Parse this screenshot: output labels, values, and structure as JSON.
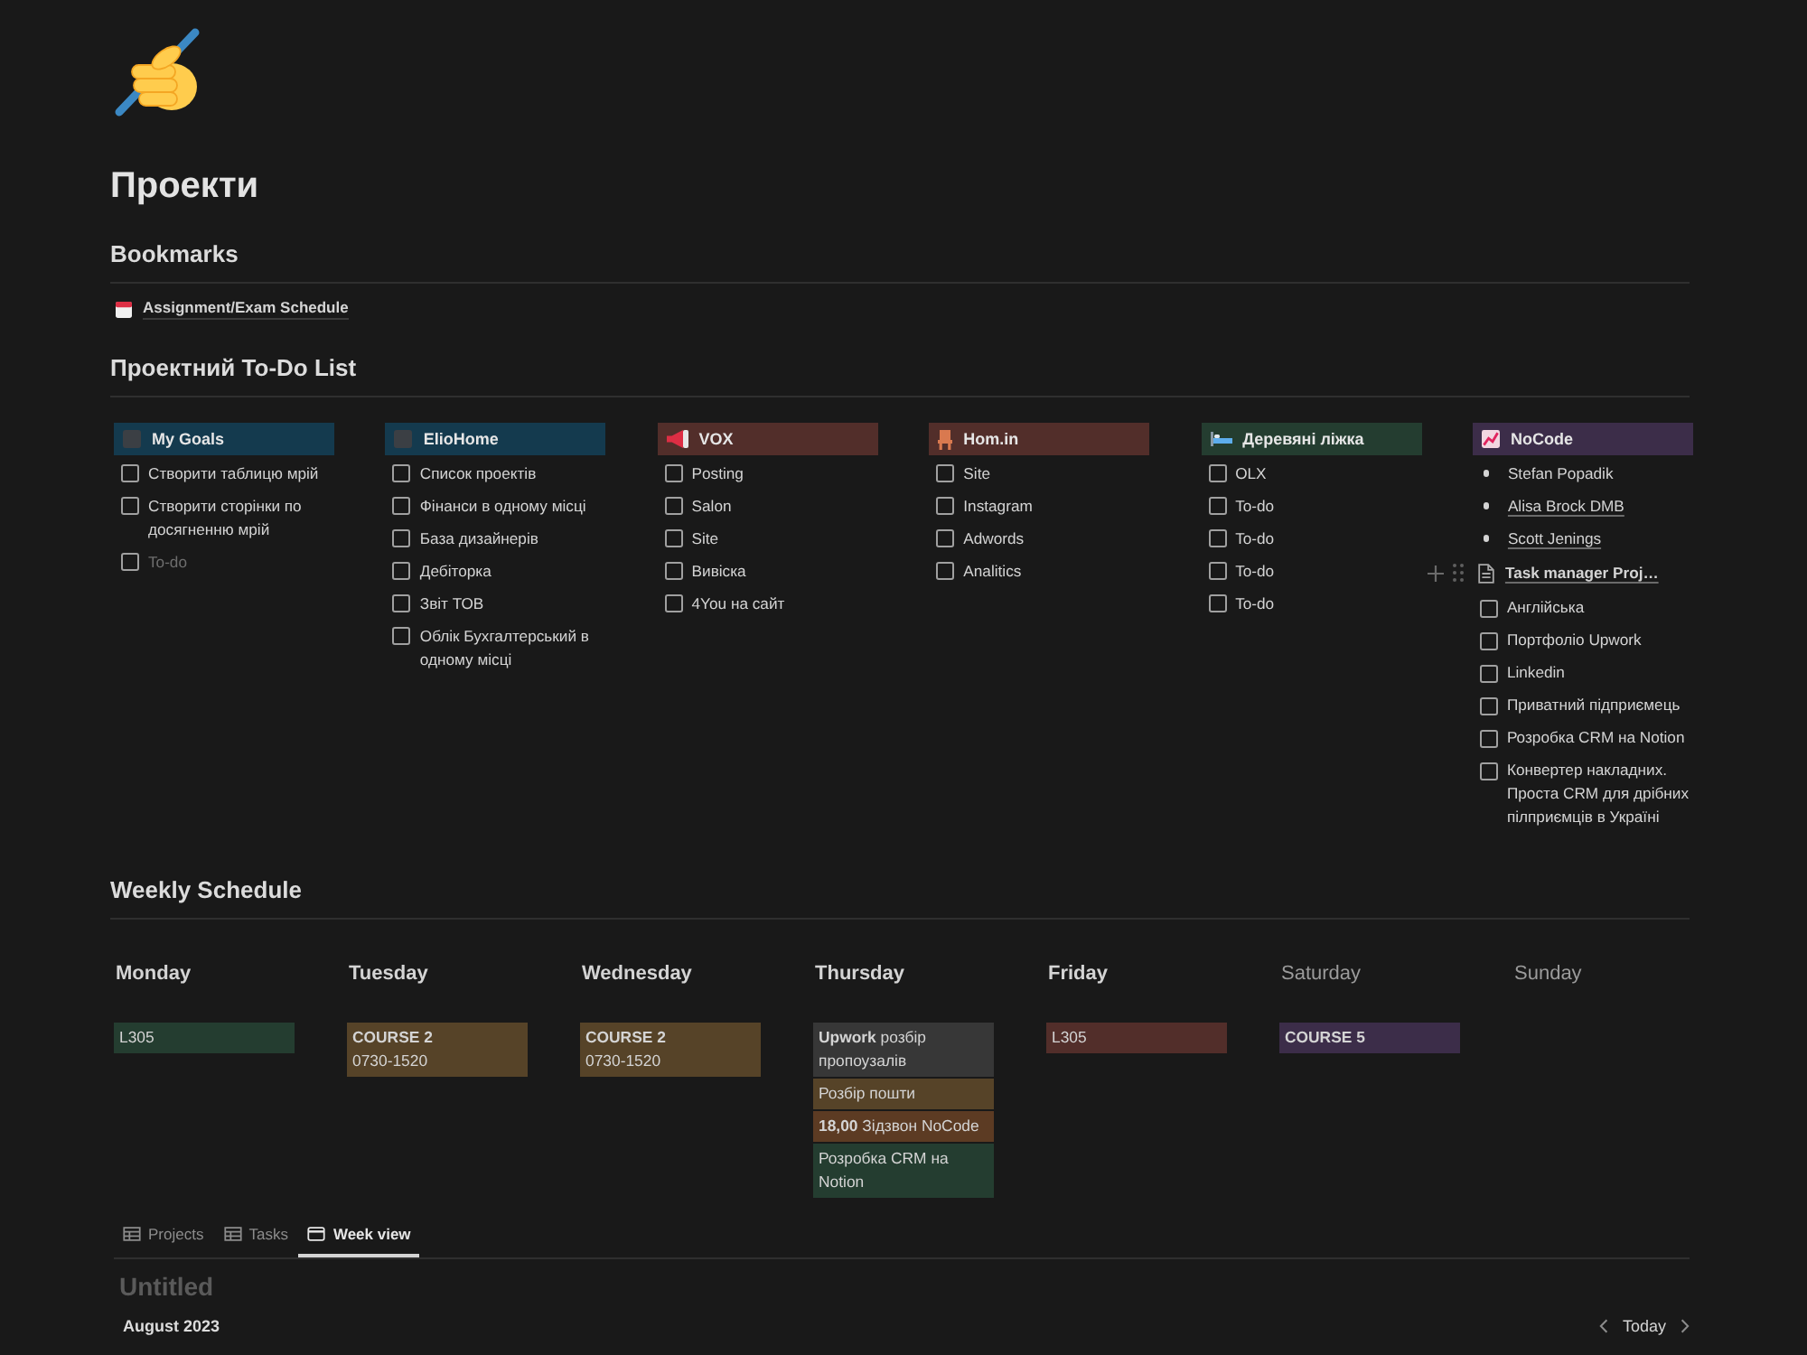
{
  "page": {
    "title": "Проекти"
  },
  "bookmarks": {
    "heading": "Bookmarks",
    "links": [
      {
        "text": "Assignment/Exam Schedule"
      }
    ]
  },
  "todo_list": {
    "heading": "Проектний To-Do List",
    "columns": [
      {
        "title": "My Goals",
        "color": "#143a4e",
        "items": [
          {
            "kind": "todo",
            "checked": false,
            "text": "Створити таблицю мрій"
          },
          {
            "kind": "todo",
            "checked": false,
            "text": "Створити сторінки по досягненню мрій"
          },
          {
            "kind": "todo",
            "checked": false,
            "placeholder": "To-do"
          }
        ]
      },
      {
        "title": "ElioHome",
        "color": "#143a4e",
        "items": [
          {
            "kind": "todo",
            "checked": false,
            "text": "Список проектів"
          },
          {
            "kind": "todo",
            "checked": false,
            "text": "Фінанси в одному місці"
          },
          {
            "kind": "todo",
            "checked": false,
            "text": "База дизайнерів"
          },
          {
            "kind": "todo",
            "checked": false,
            "text": "Дебіторка"
          },
          {
            "kind": "todo",
            "checked": false,
            "text": "Звіт ТОВ"
          },
          {
            "kind": "todo",
            "checked": false,
            "text": "Облік Бухгалтерський в одному місці"
          }
        ]
      },
      {
        "title": "VOX",
        "color": "#522e2a",
        "items": [
          {
            "kind": "todo",
            "checked": false,
            "text": "Posting"
          },
          {
            "kind": "todo",
            "checked": false,
            "text": "Salon"
          },
          {
            "kind": "todo",
            "checked": false,
            "text": "Site"
          },
          {
            "kind": "todo",
            "checked": false,
            "text": "Вивіска"
          },
          {
            "kind": "todo",
            "checked": false,
            "text": "4You на сайт"
          }
        ]
      },
      {
        "title": "Hom.in",
        "color": "#522e2a",
        "items": [
          {
            "kind": "todo",
            "checked": false,
            "text": "Site"
          },
          {
            "kind": "todo",
            "checked": false,
            "text": "Instagram"
          },
          {
            "kind": "todo",
            "checked": false,
            "text": "Adwords"
          },
          {
            "kind": "todo",
            "checked": false,
            "text": "Analitics"
          }
        ]
      },
      {
        "title": "Деревяні ліжка",
        "color": "#243d30",
        "items": [
          {
            "kind": "todo",
            "checked": false,
            "text": "OLX"
          },
          {
            "kind": "todo",
            "checked": false,
            "text": "To-do"
          },
          {
            "kind": "todo",
            "checked": false,
            "text": "To-do"
          },
          {
            "kind": "todo",
            "checked": false,
            "text": "To-do"
          },
          {
            "kind": "todo",
            "checked": false,
            "text": "To-do"
          }
        ]
      },
      {
        "title": "NoCode",
        "color": "#3c2d49",
        "items": [
          {
            "kind": "bullet",
            "hovered": false,
            "text": "Stefan Popadik"
          },
          {
            "kind": "link",
            "hovered": false,
            "text": "Alisa Brock DMB"
          },
          {
            "kind": "link",
            "hovered": false,
            "text": "Scott Jenings"
          },
          {
            "kind": "page",
            "hovered": true,
            "text": "Task manager Proj…"
          },
          {
            "kind": "todo",
            "hovered": false,
            "checked": false,
            "text": "Англійська"
          },
          {
            "kind": "todo",
            "hovered": false,
            "checked": false,
            "text": "Портфоліо Upwork"
          },
          {
            "kind": "todo",
            "hovered": false,
            "checked": false,
            "text": "Linkedin"
          },
          {
            "kind": "todo",
            "hovered": false,
            "checked": false,
            "text": "Приватний підприємець"
          },
          {
            "kind": "todo",
            "hovered": false,
            "checked": false,
            "text": "Розробка CRM на Notion"
          },
          {
            "kind": "todo",
            "hovered": false,
            "checked": false,
            "text": "Конвертер накладних. Проста CRM для дрібних пілприємців в Україні"
          }
        ]
      }
    ]
  },
  "weekly_schedule": {
    "heading": "Weekly Schedule",
    "days": [
      {
        "name": "Monday",
        "weekend": false,
        "events": [
          {
            "title": "L305",
            "bold": false,
            "color": "#243d30"
          }
        ]
      },
      {
        "name": "Tuesday",
        "weekend": false,
        "events": [
          {
            "title": "COURSE 2",
            "bold": true,
            "detail": "0730-1520",
            "color": "#564328"
          }
        ]
      },
      {
        "name": "Wednesday",
        "weekend": false,
        "events": [
          {
            "title": "COURSE 2",
            "bold": true,
            "detail": "0730-1520",
            "color": "#564328"
          }
        ]
      },
      {
        "name": "Thursday",
        "weekend": false,
        "events": [
          {
            "title": "**Upwork** розбір пропоузалів",
            "bold": false,
            "color": "#373737"
          },
          {
            "title": "Розбір пошти",
            "bold": false,
            "color": "#564328"
          },
          {
            "title": "**18,00** Зідзвон NoCode",
            "bold": false,
            "color": "#5c3b23"
          },
          {
            "title": "Розробка CRM на Notion",
            "bold": false,
            "color": "#243d30"
          }
        ]
      },
      {
        "name": "Friday",
        "weekend": false,
        "events": [
          {
            "title": "L305",
            "bold": false,
            "color": "#522e2a"
          }
        ]
      },
      {
        "name": "Saturday",
        "weekend": true,
        "events": [
          {
            "title": "COURSE 5",
            "bold": true,
            "color": "#3c2d49"
          }
        ]
      },
      {
        "name": "Sunday",
        "weekend": true
      }
    ]
  },
  "database": {
    "tabs": [
      {
        "label": "Projects",
        "kind": "table",
        "selected": false
      },
      {
        "label": "Tasks",
        "kind": "table",
        "selected": false
      },
      {
        "label": "Week view",
        "kind": "calendar",
        "selected": true
      }
    ],
    "title": "Untitled",
    "month": "August 2023",
    "today_button": "Today"
  }
}
